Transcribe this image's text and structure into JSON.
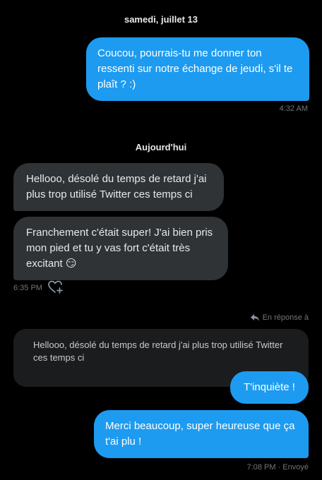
{
  "date_separators": [
    "samedi, juillet 13",
    "Aujourd'hui"
  ],
  "messages": [
    {
      "text": "Coucou, pourrais-tu me donner ton ressenti sur notre échange de jeudi, s'il te plaît ? :)",
      "time": "4:32 AM"
    },
    {
      "text": "Hellooo, désolé du temps de retard j'ai plus trop utilisé Twitter ces temps ci"
    },
    {
      "text": "Franchement c'était super! J'ai bien pris mon pied et tu y vas fort c'était très excitant 😏",
      "time": "6:35 PM"
    },
    {
      "text": "T'inquiète !"
    },
    {
      "text": "Merci beaucoup, super heureuse que ça t'ai plu !",
      "time": "7:08 PM · Envoyé"
    }
  ],
  "reply": {
    "context_label": "En réponse à",
    "quoted_text": "Hellooo, désolé du temps de retard j'ai plus trop utilisé Twitter ces temps ci"
  },
  "icons": {
    "react": "heart-plus-icon",
    "reply": "reply-arrow-icon"
  },
  "colors": {
    "outgoing": "#1d9bf0",
    "incoming": "#2f3336",
    "background": "#000000",
    "muted": "#71767b"
  }
}
